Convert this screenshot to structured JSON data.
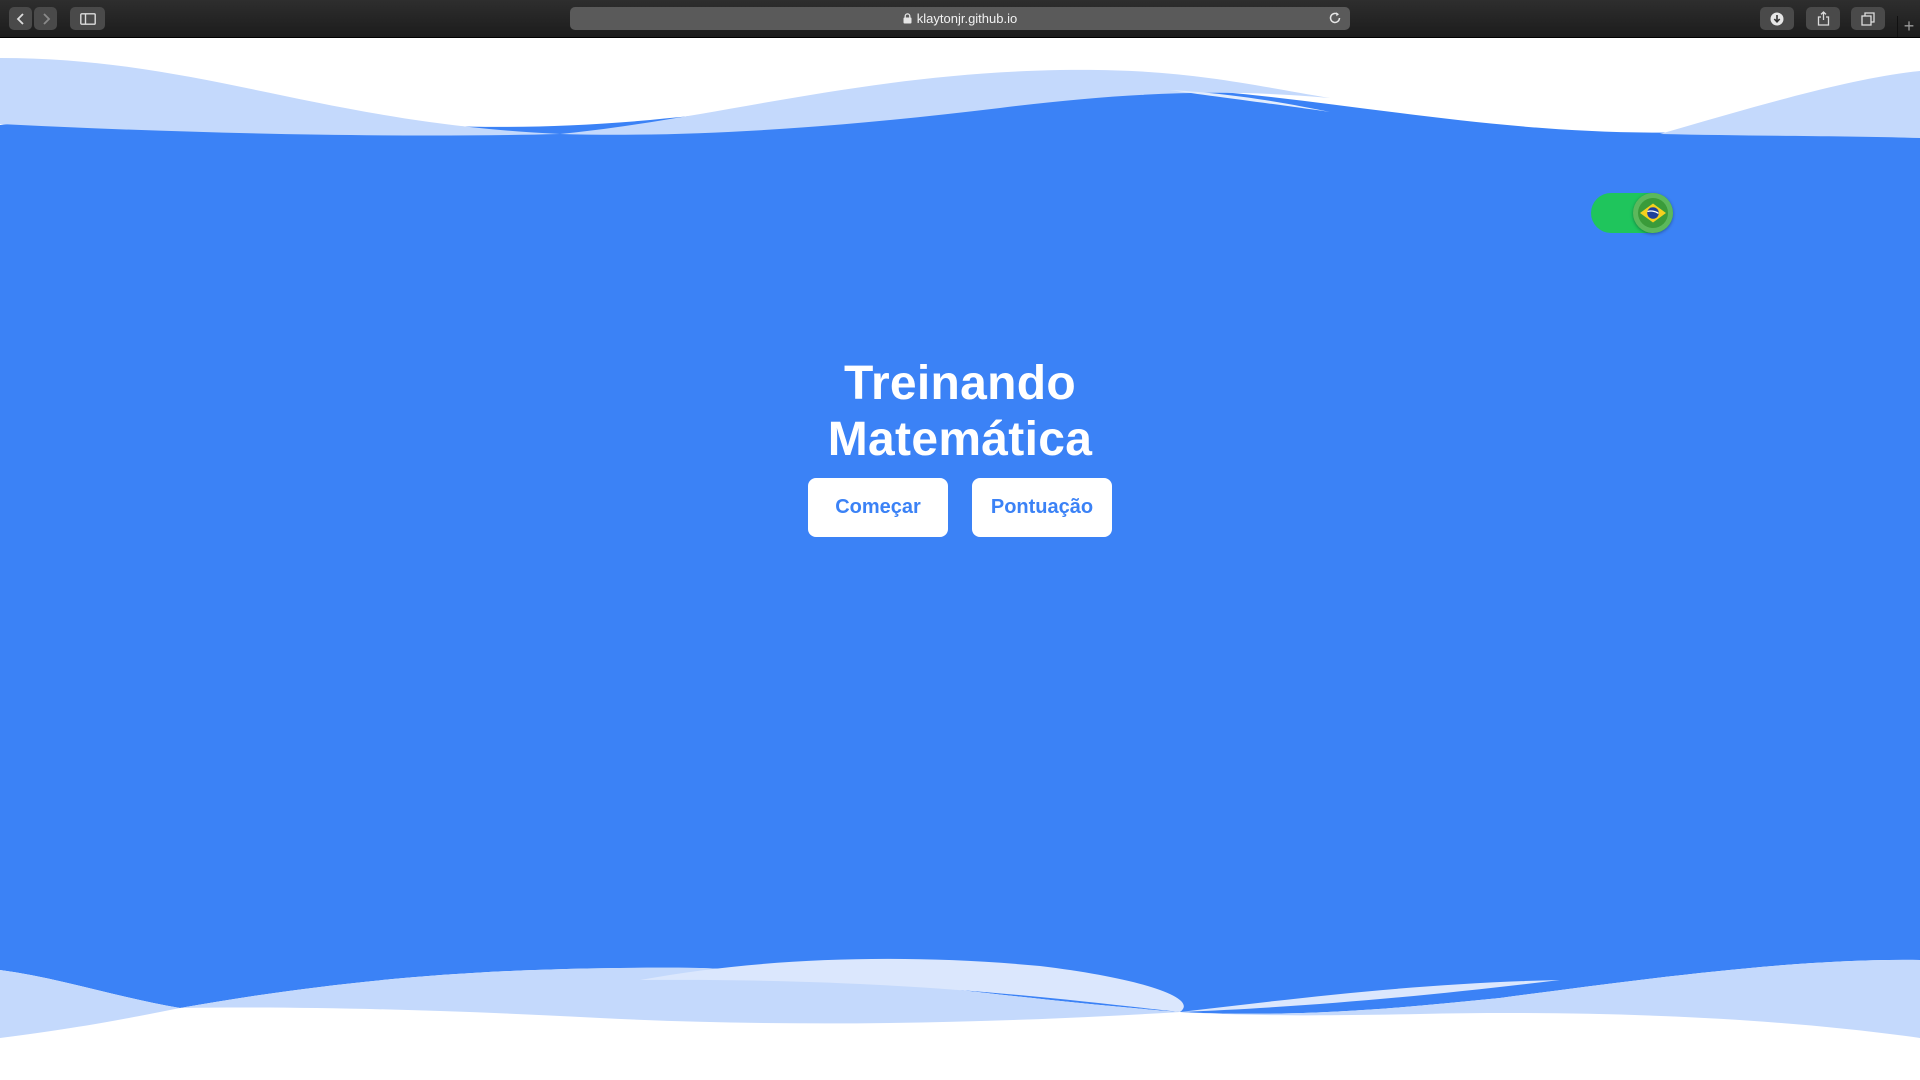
{
  "browser": {
    "url": "klaytonjr.github.io",
    "new_tab": "+"
  },
  "icons": {
    "back": "chevron-left-icon",
    "forward": "chevron-right-icon",
    "sidebar": "sidebar-icon",
    "lock": "lock-icon",
    "reload": "reload-icon",
    "download": "download-icon",
    "share": "share-icon",
    "tabs": "tabs-icon",
    "language_flag": "brazil-flag-icon"
  },
  "colors": {
    "background": "#3b82f6",
    "wave_light": "#c4d9fc",
    "button_text": "#3b82f6",
    "toggle": "#1fc55c"
  },
  "page": {
    "title_line1": "Treinando",
    "title_line2": "Matemática",
    "start_button": "Começar",
    "score_button": "Pontuação",
    "language_toggle_on": true
  }
}
